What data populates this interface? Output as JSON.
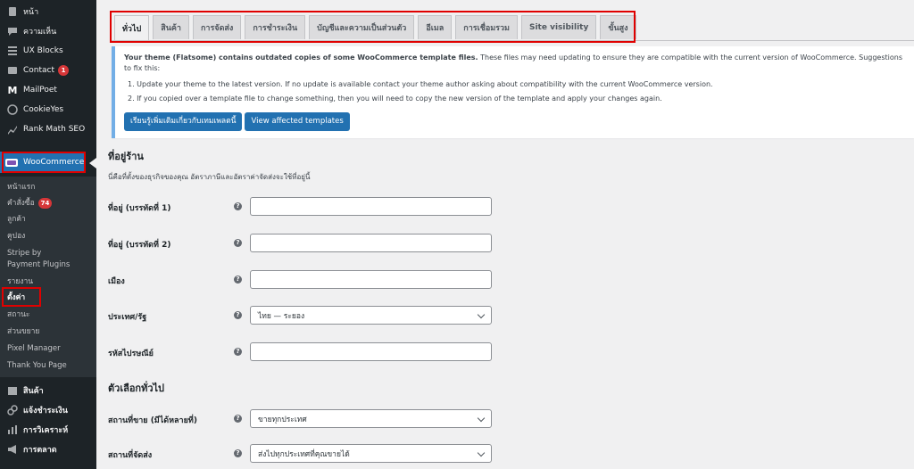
{
  "sidebar": {
    "top_items": [
      {
        "label": "หน้า",
        "icon": "page-icon"
      },
      {
        "label": "ความเห็น",
        "icon": "comment-icon"
      },
      {
        "label": "UX Blocks",
        "icon": "blocks-icon"
      },
      {
        "label": "Contact",
        "icon": "mail-icon",
        "badge": "1"
      },
      {
        "label": "MailPoet",
        "icon": "mailpoet-icon"
      },
      {
        "label": "CookieYes",
        "icon": "cookie-icon"
      },
      {
        "label": "Rank Math SEO",
        "icon": "chart-icon"
      }
    ],
    "woocommerce": "WooCommerce",
    "submenu": [
      {
        "label": "หน้าแรก"
      },
      {
        "label": "คำสั่งซื้อ",
        "badge": "74"
      },
      {
        "label": "ลูกค้า"
      },
      {
        "label": "คูปอง"
      },
      {
        "label": "Stripe by"
      },
      {
        "label": "Payment Plugins"
      },
      {
        "label": "รายงาน"
      },
      {
        "label": "ตั้งค่า"
      },
      {
        "label": "สถานะ"
      },
      {
        "label": "ส่วนขยาย"
      },
      {
        "label": "Pixel Manager"
      },
      {
        "label": "Thank You Page"
      }
    ],
    "lower_items": [
      {
        "label": "สินค้า",
        "icon": "box-icon"
      },
      {
        "label": "แจ้งชำระเงิน",
        "icon": "link-icon"
      },
      {
        "label": "การวิเคราะห์",
        "icon": "bar-chart-icon"
      },
      {
        "label": "การตลาด",
        "icon": "megaphone-icon"
      }
    ]
  },
  "tabs": [
    "ทั่วไป",
    "สินค้า",
    "การจัดส่ง",
    "การชำระเงิน",
    "บัญชีและความเป็นส่วนตัว",
    "อีเมล",
    "การเชื่อมรวม",
    "Site visibility",
    "ขั้นสูง"
  ],
  "notice": {
    "text_bold": "Your theme (Flatsome) contains outdated copies of some WooCommerce template files.",
    "text_rest": " These files may need updating to ensure they are compatible with the current version of WooCommerce. Suggestions to fix this:",
    "item1": "1. Update your theme to the latest version. If no update is available contact your theme author asking about compatibility with the current WooCommerce version.",
    "item2": "2. If you copied over a template file to change something, then you will need to copy the new version of the template and apply your changes again.",
    "button1": "เรียนรู้เพิ่มเติมเกี่ยวกับเทมเพลตนี้",
    "button2": "View affected templates"
  },
  "store_address": {
    "title": "ที่อยู่ร้าน",
    "desc": "นี่คือที่ตั้งของธุรกิจของคุณ อัตราภาษีและอัตราค่าจัดส่งจะใช้ที่อยู่นี้",
    "address1_label": "ที่อยู่ (บรรทัดที่ 1)",
    "address1_value": "",
    "address2_label": "ที่อยู่ (บรรทัดที่ 2)",
    "address2_value": "",
    "city_label": "เมือง",
    "city_value": "",
    "country_label": "ประเทศ/รัฐ",
    "country_value": "ไทย — ระยอง",
    "postcode_label": "รหัสไปรษณีย์",
    "postcode_value": ""
  },
  "general_options": {
    "title": "ตัวเลือกทั่วไป",
    "sell_label": "สถานที่ขาย (มีได้หลายที่)",
    "sell_value": "ขายทุกประเทศ",
    "ship_label": "สถานที่จัดส่ง",
    "ship_value": "ส่งไปทุกประเทศที่คุณขายได้"
  },
  "help_glyph": "?"
}
